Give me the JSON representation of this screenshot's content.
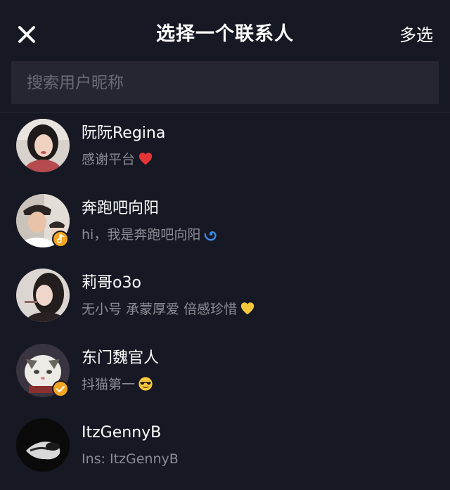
{
  "header": {
    "title": "选择一个联系人",
    "multi_select_label": "多选",
    "close_icon": "close-icon"
  },
  "search": {
    "placeholder": "搜索用户昵称",
    "value": ""
  },
  "colors": {
    "background": "#161823",
    "search_background": "#252632",
    "primary_text": "#ffffff",
    "secondary_text": "#8b8c94",
    "badge": "#f3a522"
  },
  "contacts": [
    {
      "name": "阮阮Regina",
      "subtitle": "感谢平台",
      "emoji": "red-heart-icon",
      "badge": ""
    },
    {
      "name": "奔跑吧向阳",
      "subtitle": "hi，我是奔跑吧向阳",
      "emoji": "cyclone-icon",
      "badge": "music-note-badge-icon"
    },
    {
      "name": "莉哥o3o",
      "subtitle": "无小号 承蒙厚爱 倍感珍惜",
      "emoji": "yellow-heart-icon",
      "badge": ""
    },
    {
      "name": "东门魏官人",
      "subtitle": "抖猫第一",
      "emoji": "sunglasses-face-icon",
      "badge": "verified-check-badge-icon"
    },
    {
      "name": "ItzGennyB",
      "subtitle": "Ins: ItzGennyB",
      "emoji": "",
      "badge": ""
    }
  ]
}
